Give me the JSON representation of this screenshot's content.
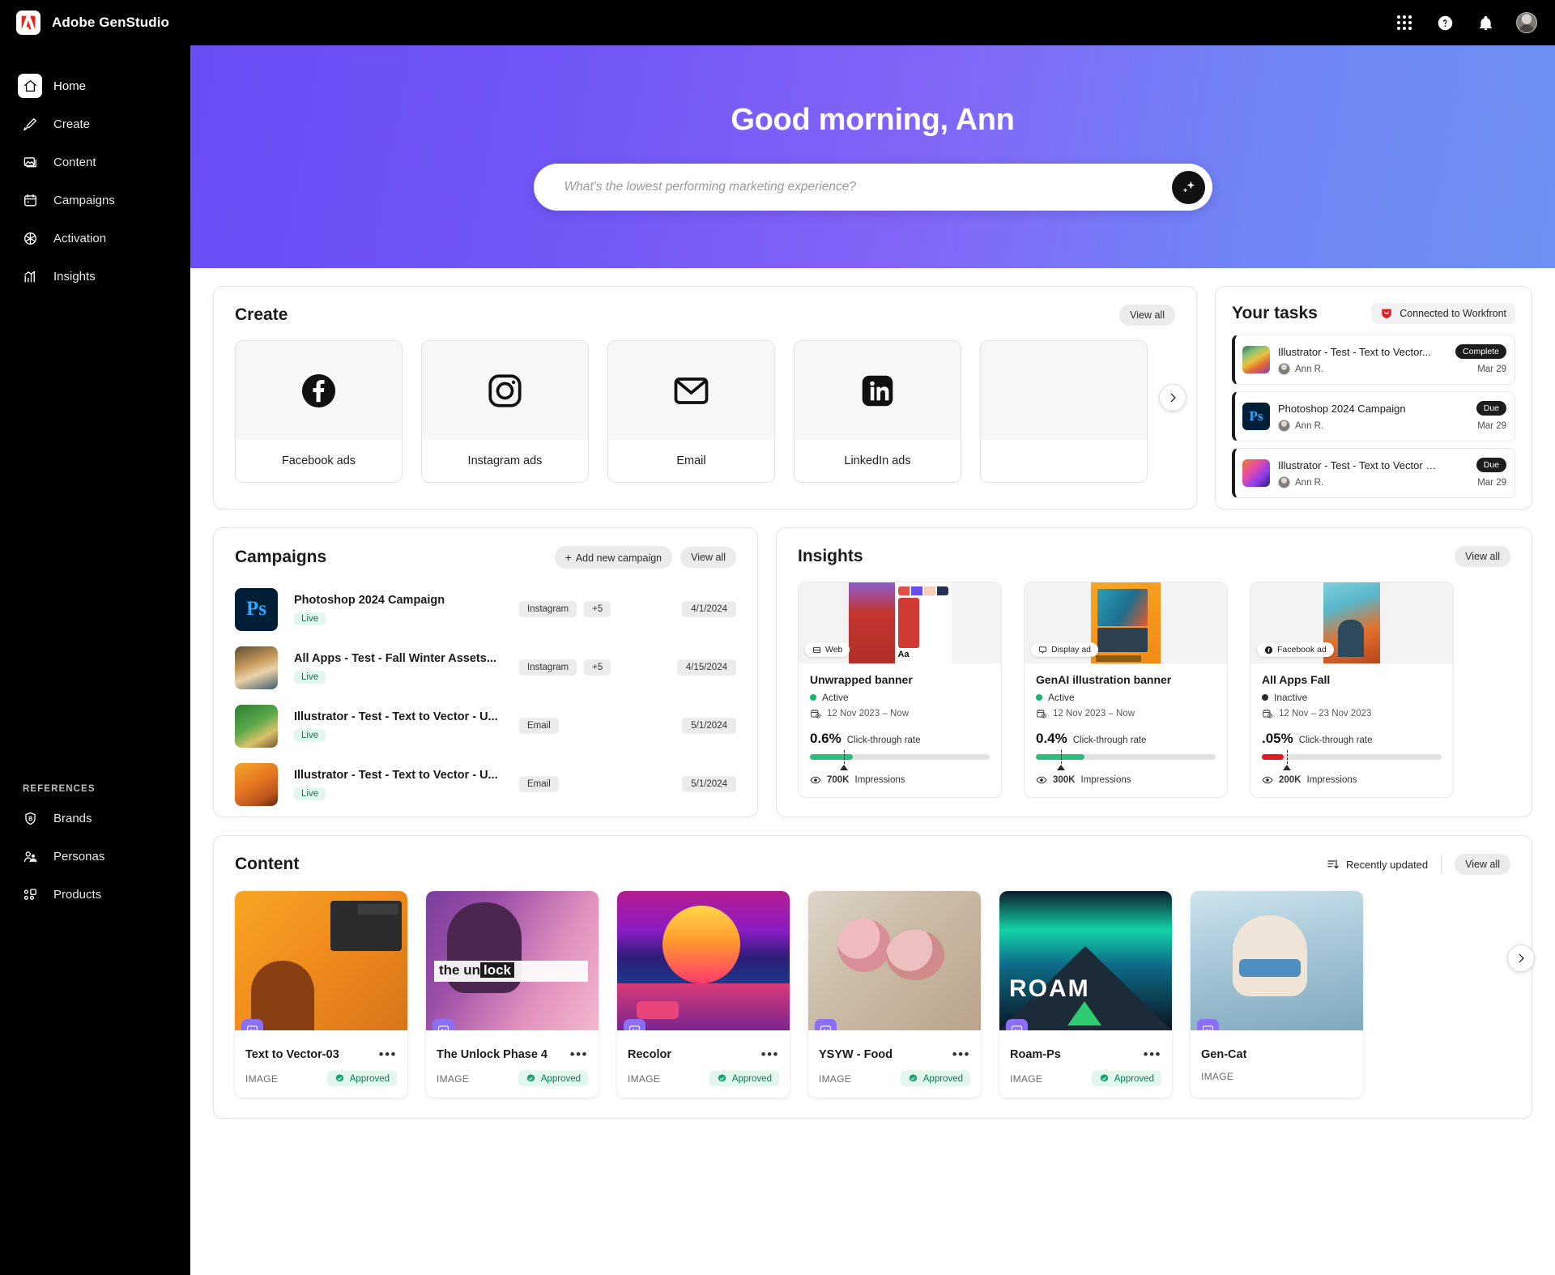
{
  "app": {
    "brand": "Adobe GenStudio",
    "accent": "#6a4df5",
    "topbar_icons": [
      "apps-grid-icon",
      "help-icon",
      "notifications-bell-icon",
      "user-avatar"
    ]
  },
  "sidebar": {
    "items": [
      {
        "label": "Home",
        "icon": "home-icon",
        "active": true
      },
      {
        "label": "Create",
        "icon": "brush-icon",
        "active": false
      },
      {
        "label": "Content",
        "icon": "image-icon",
        "active": false
      },
      {
        "label": "Campaigns",
        "icon": "calendar-icon",
        "active": false
      },
      {
        "label": "Activation",
        "icon": "aperture-icon",
        "active": false
      },
      {
        "label": "Insights",
        "icon": "bar-chart-icon",
        "active": false
      }
    ],
    "references_label": "REFERENCES",
    "reference_items": [
      {
        "label": "Brands",
        "icon": "brand-shield-icon"
      },
      {
        "label": "Personas",
        "icon": "personas-icon"
      },
      {
        "label": "Products",
        "icon": "products-icon"
      }
    ]
  },
  "hero": {
    "greeting": "Good morning, Ann",
    "search_placeholder": "What's the lowest performing marketing experience?",
    "search_value": "",
    "submit_icon": "sparkle-icon"
  },
  "create": {
    "title": "Create",
    "view_all": "View all",
    "next_icon": "chevron-right-icon",
    "tiles": [
      {
        "label": "Facebook ads",
        "icon": "facebook-icon"
      },
      {
        "label": "Instagram ads",
        "icon": "instagram-icon"
      },
      {
        "label": "Email",
        "icon": "email-icon"
      },
      {
        "label": "LinkedIn ads",
        "icon": "linkedin-icon"
      },
      {
        "label": "",
        "icon": "partial-tile"
      }
    ]
  },
  "tasks": {
    "title": "Your tasks",
    "connected_label": "Connected to Workfront",
    "connected_icon": "workfront-icon",
    "items": [
      {
        "name": "Illustrator -  Test - Text to Vector...",
        "user": "Ann R.",
        "date": "Mar 29",
        "badge": "Complete",
        "thumb": "cat-illustration"
      },
      {
        "name": "Photoshop 2024 Campaign",
        "user": "Ann R.",
        "date": "Mar 29",
        "badge": "Due",
        "thumb": "photoshop-app-icon"
      },
      {
        "name": "Illustrator - Test - Text to Vector - US...",
        "user": "Ann R.",
        "date": "Mar 29",
        "badge": "Due",
        "thumb": "abstract-illustration"
      }
    ]
  },
  "campaigns": {
    "title": "Campaigns",
    "add_label": "Add new campaign",
    "view_all": "View all",
    "rows": [
      {
        "name": "Photoshop 2024 Campaign",
        "status": "Live",
        "tags": [
          "Instagram",
          "+5"
        ],
        "date": "4/1/2024",
        "thumb": "photoshop-app-icon"
      },
      {
        "name": "All Apps - Test - Fall Winter Assets...",
        "status": "Live",
        "tags": [
          "Instagram",
          "+5"
        ],
        "date": "4/15/2024",
        "thumb": "winter-cat-illustration"
      },
      {
        "name": "Illustrator - Test - Text to Vector - U...",
        "status": "Live",
        "tags": [
          "Email"
        ],
        "date": "5/1/2024",
        "thumb": "man-green-shirt-photo"
      },
      {
        "name": "Illustrator - Test - Text to Vector - U...",
        "status": "Live",
        "tags": [
          "Email"
        ],
        "date": "5/1/2024",
        "thumb": "man-orange-shirt-photo"
      }
    ]
  },
  "insights": {
    "title": "Insights",
    "view_all": "View all",
    "cards": [
      {
        "channel": "Web",
        "channel_icon": "web-icon",
        "name": "Unwrapped banner",
        "status": "Active",
        "status_color": "#15b66e",
        "dates": "12 Nov 2023 – Now",
        "ctr_value": "0.6%",
        "ctr_label": "Click-through rate",
        "bar_pct": 24,
        "bar_color": "#2dbd7e",
        "marker_pct": 19,
        "impressions_value": "700K",
        "impressions_label": "Impressions",
        "media": "red-portrait-brand-kit"
      },
      {
        "channel": "Display ad",
        "channel_icon": "display-ad-icon",
        "name": "GenAI illustration banner",
        "status": "Active",
        "status_color": "#15b66e",
        "dates": "12 Nov 2023 – Now",
        "ctr_value": "0.4%",
        "ctr_label": "Click-through rate",
        "bar_pct": 27,
        "bar_color": "#2dbd7e",
        "marker_pct": 14,
        "impressions_value": "300K",
        "impressions_label": "Impressions",
        "media": "orange-illustrator-poster"
      },
      {
        "channel": "Facebook ad",
        "channel_icon": "facebook-icon",
        "name": "All Apps Fall",
        "status": "Inactive",
        "status_color": "#2b2b2b",
        "dates": "12 Nov – 23 Nov 2023",
        "ctr_value": ".05%",
        "ctr_label": "Click-through rate",
        "bar_pct": 12,
        "bar_color": "#e01b24",
        "marker_pct": 14,
        "impressions_value": "200K",
        "impressions_label": "Impressions",
        "media": "woman-autumn-illustration"
      }
    ]
  },
  "content": {
    "title": "Content",
    "sort_label": "Recently updated",
    "sort_icon": "sort-descending-icon",
    "view_all": "View all",
    "next_icon": "chevron-right-icon",
    "items": [
      {
        "name": "Text to Vector-03",
        "type": "IMAGE",
        "status": "Approved",
        "media": "orange-astronaut-cat-ui"
      },
      {
        "name": "The Unlock Phase 4",
        "type": "IMAGE",
        "status": "Approved",
        "media": "the-unlock-portrait"
      },
      {
        "name": "Recolor",
        "type": "IMAGE",
        "status": "Approved",
        "media": "synthwave-sunset-car"
      },
      {
        "name": "YSYW - Food",
        "type": "IMAGE",
        "status": "Approved",
        "media": "food-plate-photo"
      },
      {
        "name": "Roam-Ps",
        "type": "IMAGE",
        "status": "Approved",
        "media": "roam-aurora-mountain"
      },
      {
        "name": "Gen-Cat",
        "type": "IMAGE",
        "status": "",
        "media": "winter-scarf-cat"
      }
    ]
  }
}
